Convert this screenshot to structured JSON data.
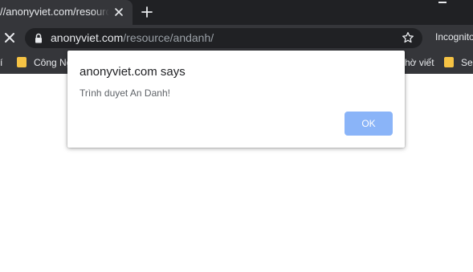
{
  "tab": {
    "title": "//anonyviet.com/resource/andanh/"
  },
  "address_bar": {
    "host": "anonyviet.com",
    "path": "/resource/andanh/"
  },
  "profile": {
    "label": "Incognito"
  },
  "bookmarks": {
    "items": [
      {
        "label": "í"
      },
      {
        "label": "Công Ng"
      },
      {
        "label": "hờ viết"
      },
      {
        "label": "Ser"
      }
    ]
  },
  "dialog": {
    "title": "anonyviet.com says",
    "message": "Trình duyet An Danh!",
    "ok_label": "OK"
  },
  "icons": {
    "tab_close": "close-icon",
    "new_tab": "plus-icon",
    "stop": "close-icon",
    "secure": "lock-icon",
    "bookmark": "star-icon",
    "folder": "folder-icon"
  },
  "colors": {
    "frame": "#202124",
    "toolbar": "#35363a",
    "accent_button": "#8ab4f8",
    "bookmark_folder": "#f6c344"
  }
}
